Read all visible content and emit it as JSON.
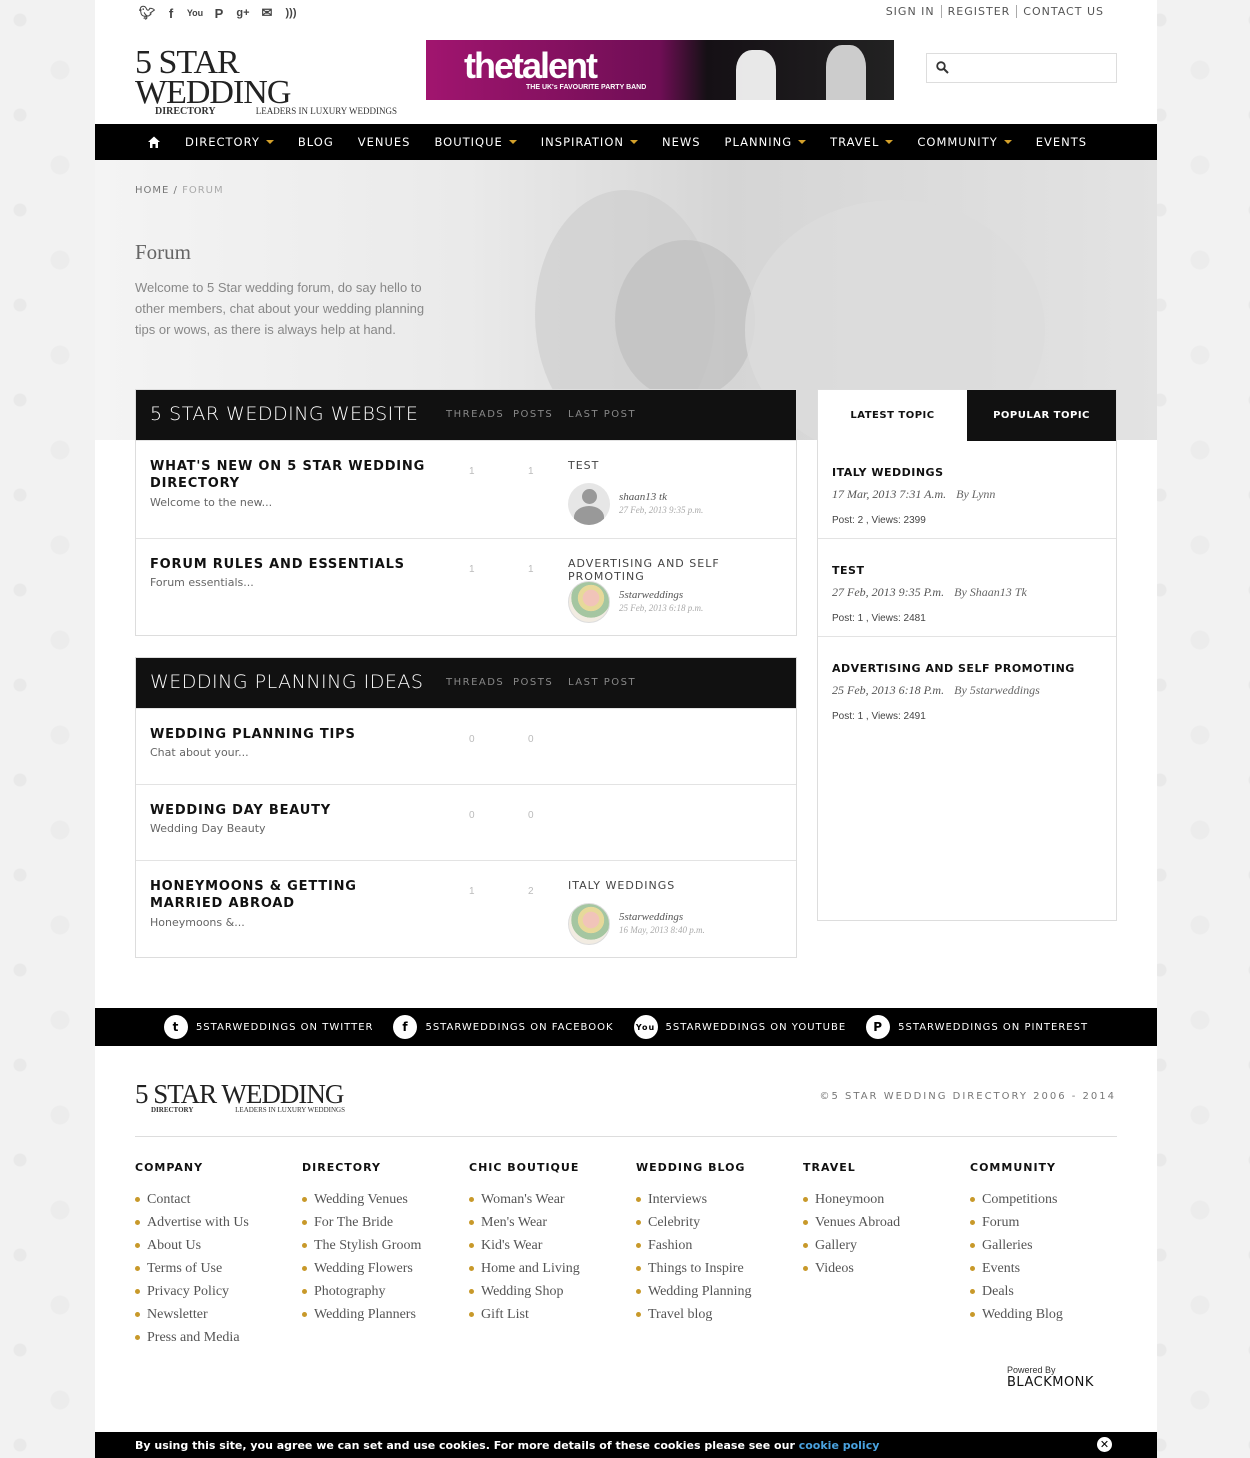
{
  "top_links": [
    "SIGN IN",
    "REGISTER",
    "CONTACT US"
  ],
  "logo": {
    "main": "5 STAR WEDDING",
    "sub1": "DIRECTORY",
    "sub2": "LEADERS IN LUXURY WEDDINGS"
  },
  "banner": {
    "title": "thetalent",
    "subtitle": "THE UK's FAVOURITE PARTY BAND"
  },
  "search": {
    "placeholder": ""
  },
  "nav": [
    "DIRECTORY",
    "BLOG",
    "VENUES",
    "BOUTIQUE",
    "INSPIRATION",
    "NEWS",
    "PLANNING",
    "TRAVEL",
    "COMMUNITY",
    "EVENTS"
  ],
  "breadcrumb": {
    "home": "HOME",
    "sep": "/",
    "current": "FORUM"
  },
  "hero": {
    "title": "Forum",
    "text": "Welcome to 5 Star wedding forum, do say hello to other members, chat about your wedding planning tips or wows, as there is always help at hand."
  },
  "forums": [
    {
      "title": "5 STAR WEDDING WEBSITE",
      "cols": [
        "THREADS",
        "POSTS",
        "LAST POST"
      ],
      "rows": [
        {
          "title": "WHAT'S NEW ON 5 STAR WEDDING DIRECTORY",
          "desc": "Welcome to the new...",
          "threads": "1",
          "posts": "1",
          "last_title": "TEST",
          "last_user": "shaan13 tk",
          "last_date": "27 Feb, 2013 9:35 p.m."
        },
        {
          "title": "FORUM RULES AND ESSENTIALS",
          "desc": "Forum essentials...",
          "threads": "1",
          "posts": "1",
          "last_title": "ADVERTISING AND SELF PROMOTING",
          "last_user": "5starweddings",
          "last_date": "25 Feb, 2013 6:18 p.m."
        }
      ]
    },
    {
      "title": "WEDDING PLANNING IDEAS",
      "cols": [
        "THREADS",
        "POSTS",
        "LAST POST"
      ],
      "rows": [
        {
          "title": "WEDDING PLANNING TIPS",
          "desc": "Chat about your...",
          "threads": "0",
          "posts": "0"
        },
        {
          "title": "WEDDING DAY BEAUTY",
          "desc": "Wedding Day Beauty",
          "threads": "0",
          "posts": "0"
        },
        {
          "title": "HONEYMOONS & GETTING MARRIED ABROAD",
          "desc": "Honeymoons &...",
          "threads": "1",
          "posts": "2",
          "last_title": "ITALY WEDDINGS",
          "last_user": "5starweddings",
          "last_date": "16 May, 2013 8:40 p.m."
        }
      ]
    }
  ],
  "side": {
    "tabs": [
      "LATEST TOPIC",
      "POPULAR TOPIC"
    ],
    "topics": [
      {
        "title": "ITALY WEDDINGS",
        "date": "17 Mar, 2013 7:31 A.m.",
        "by": "By Lynn",
        "stats": "Post: 2 ,   Views: 2399"
      },
      {
        "title": "TEST",
        "date": "27 Feb, 2013 9:35 P.m.",
        "by": "By Shaan13 Tk",
        "stats": "Post: 1 ,   Views: 2481"
      },
      {
        "title": "ADVERTISING AND SELF PROMOTING",
        "date": "25 Feb, 2013 6:18 P.m.",
        "by": "By 5starweddings",
        "stats": "Post: 1 ,   Views: 2491"
      }
    ]
  },
  "social_bar": [
    "5STARWEDDINGS ON TWITTER",
    "5STARWEDDINGS ON FACEBOOK",
    "5STARWEDDINGS ON YOUTUBE",
    "5STARWEDDINGS ON PINTEREST"
  ],
  "footer": {
    "copyright": "©5 STAR WEDDING DIRECTORY 2006 - 2014",
    "columns": [
      {
        "title": "COMPANY",
        "items": [
          "Contact",
          "Advertise with Us",
          "About Us",
          "Terms of Use",
          "Privacy Policy",
          "Newsletter",
          "Press and Media"
        ]
      },
      {
        "title": "DIRECTORY",
        "items": [
          "Wedding Venues",
          "For The Bride",
          "The Stylish Groom",
          "Wedding Flowers",
          "Photography",
          "Wedding Planners"
        ]
      },
      {
        "title": "CHIC BOUTIQUE",
        "items": [
          "Woman's Wear",
          "Men's Wear",
          "Kid's Wear",
          "Home and Living",
          "Wedding Shop",
          "Gift List"
        ]
      },
      {
        "title": "WEDDING BLOG",
        "items": [
          "Interviews",
          "Celebrity",
          "Fashion",
          "Things to Inspire",
          "Wedding Planning",
          "Travel blog"
        ]
      },
      {
        "title": "TRAVEL",
        "items": [
          "Honeymoon",
          "Venues Abroad",
          "Gallery",
          "Videos"
        ]
      },
      {
        "title": "COMMUNITY",
        "items": [
          "Competitions",
          "Forum",
          "Galleries",
          "Events",
          "Deals",
          "Wedding Blog"
        ]
      }
    ],
    "powered_label": "Powered By",
    "powered_brand": "BLACKMONK"
  },
  "cookie": {
    "text": "By using this site, you agree we can set and use cookies. For more details of these cookies please see our",
    "link": "cookie policy"
  }
}
